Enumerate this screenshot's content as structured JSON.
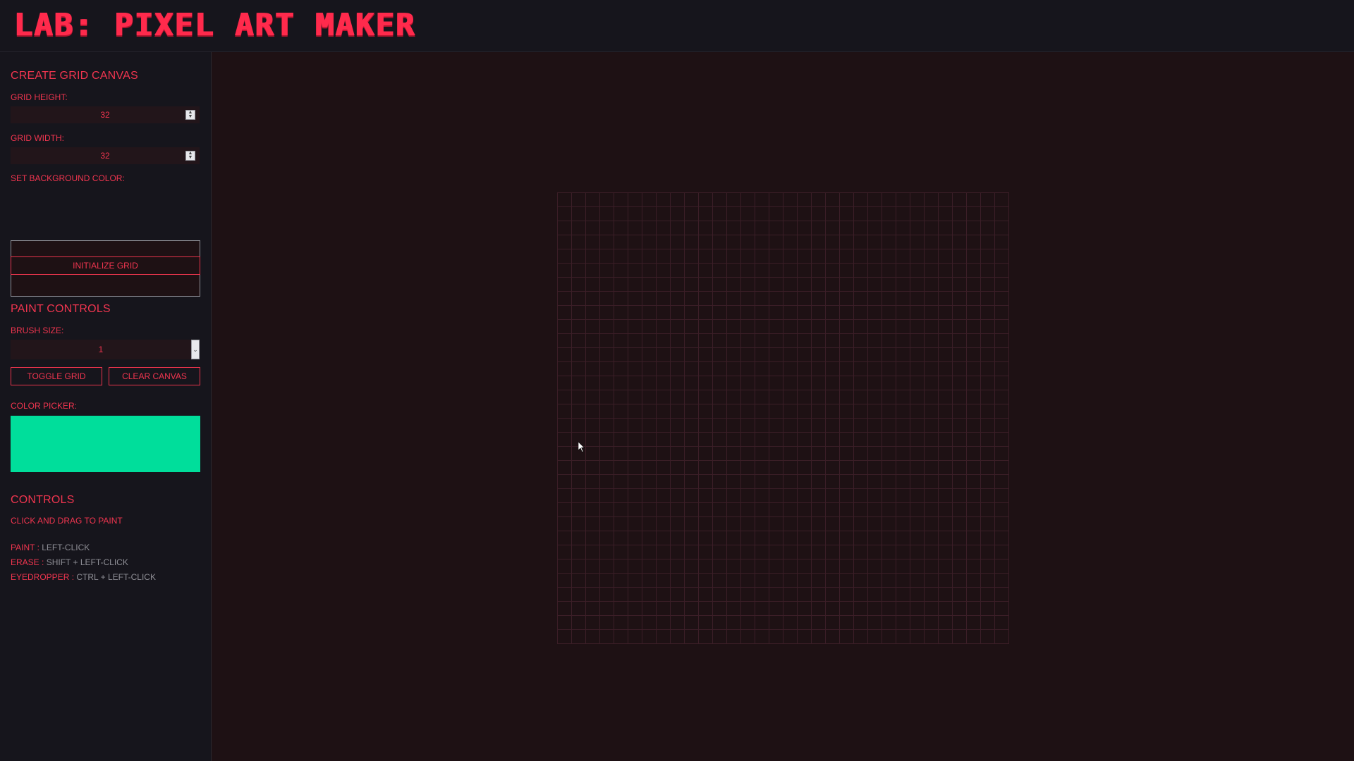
{
  "app": {
    "title": "LAB: PIXEL ART MAKER"
  },
  "sidebar": {
    "create_grid": {
      "title": "CREATE GRID CANVAS",
      "height_label": "GRID HEIGHT:",
      "height_value": "32",
      "width_label": "GRID WIDTH:",
      "width_value": "32",
      "bg_color_label": "SET BACKGROUND COLOR:",
      "bg_color_value": "#1e1114",
      "init_button": "INITIALIZE GRID"
    },
    "paint_controls": {
      "title": "PAINT CONTROLS",
      "brush_label": "BRUSH SIZE:",
      "brush_value": "1",
      "toggle_grid_button": "TOGGLE GRID",
      "clear_canvas_button": "CLEAR CANVAS",
      "color_picker_label": "COLOR PICKER:",
      "color_value": "#00de9b"
    },
    "controls": {
      "title": "CONTROLS",
      "subtitle": "CLICK AND DRAG TO PAINT",
      "items": [
        {
          "key": "PAINT :",
          "value": "LEFT-CLICK"
        },
        {
          "key": "ERASE :",
          "value": "SHIFT + LEFT-CLICK"
        },
        {
          "key": "EYEDROPPER :",
          "value": "CTRL + LEFT-CLICK"
        }
      ]
    }
  },
  "canvas": {
    "rows": 32,
    "cols": 32
  },
  "colors": {
    "accent": "#e8344c",
    "title": "#ff2a4c",
    "sidebar_bg": "#16151c",
    "canvas_bg": "#1e1114",
    "grid_line": "#3b1e27"
  },
  "icons": {
    "spinner": "up-down-arrows",
    "dropdown": "chevron-down",
    "cursor": "mouse-pointer"
  }
}
